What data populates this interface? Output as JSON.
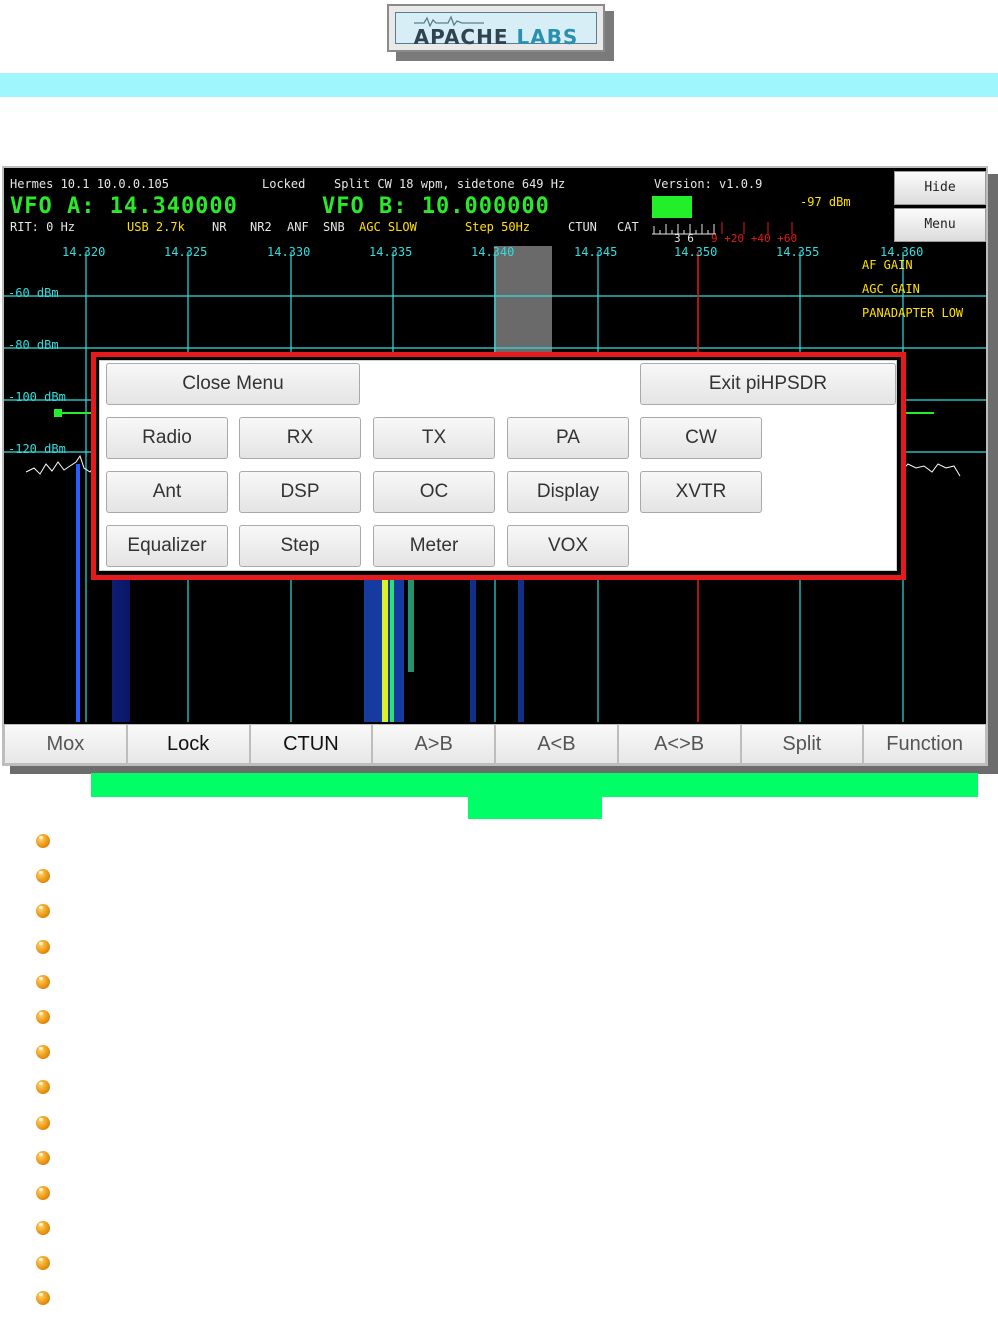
{
  "logo": {
    "text_a": "APACHE",
    "text_b": "LABS"
  },
  "header": {
    "device": "Hermes 10.1 10.0.0.105",
    "status": "Locked",
    "mode_info": "Split CW 18 wpm, sidetone 649 Hz",
    "version": "Version: v1.0.9",
    "vfo_a": "VFO A: 14.340000",
    "vfo_b": "VFO B: 10.000000",
    "rit": "RIT: 0 Hz",
    "mode_bw": "USB 2.7k",
    "nr": "NR",
    "nr2": "NR2",
    "anf": "ANF",
    "snb": "SNB",
    "agc": "AGC SLOW",
    "step": "Step 50Hz",
    "ctun": "CTUN",
    "cat": "CAT",
    "dbm": "-97 dBm",
    "s_low": "3  6",
    "s_high": "9 +20 +40 +60"
  },
  "side_buttons": {
    "hide": "Hide",
    "menu": "Menu"
  },
  "panadapter": {
    "freqs": [
      "14.320",
      "14.325",
      "14.330",
      "14.335",
      "14.340",
      "14.345",
      "14.350",
      "14.355",
      "14.360"
    ],
    "dbm_labels": [
      "-60 dBm",
      "-80 dBm",
      "-100 dBm",
      "-120 dBm"
    ],
    "right_labels": [
      "AF GAIN",
      "AGC GAIN",
      "PANADAPTER LOW"
    ],
    "colors": {
      "grid": "#2fdfe0",
      "spectrum": "#ffffff",
      "vfo_marker": "#e51a1a"
    }
  },
  "menu": {
    "close": "Close Menu",
    "exit": "Exit piHPSDR",
    "items": [
      "Radio",
      "RX",
      "TX",
      "PA",
      "CW",
      "Ant",
      "DSP",
      "OC",
      "Display",
      "XVTR",
      "Equalizer",
      "Step",
      "Meter",
      "VOX"
    ]
  },
  "bottom_buttons": [
    "Mox",
    "Lock",
    "CTUN",
    "A>B",
    "A<B",
    "A<>B",
    "Split",
    "Function"
  ],
  "bullet_count": 14
}
